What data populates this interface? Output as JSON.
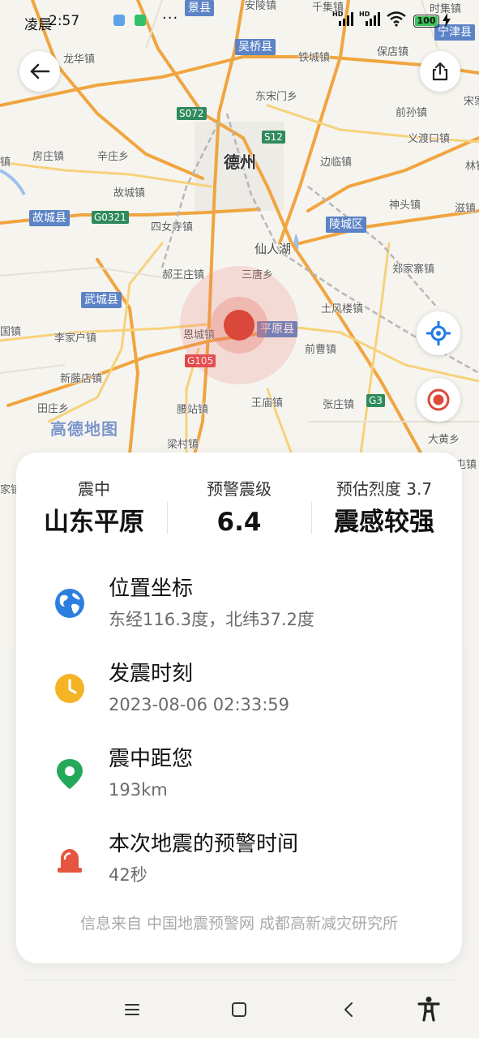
{
  "status_bar": {
    "time": "2:57",
    "weather_label": "凌晨",
    "more": "···",
    "hd1": "HD",
    "hd2": "HD",
    "battery": "100"
  },
  "map": {
    "labels": {
      "dezhou": "德州",
      "anzhen": "安陵镇",
      "qianjizhen": "千集镇",
      "longquan": "龙华镇",
      "tiechengzhen": "铁城镇",
      "baodian": "保店镇",
      "dongsongmen": "东宋门乡",
      "qiansun": "前孙镇",
      "yidukou": "义渡口镇",
      "fangzhuang": "房庄镇",
      "xinzhuang": "辛庄乡",
      "bianlin": "边临镇",
      "gucheng": "故城镇",
      "shentou": "神头镇",
      "zigou": "滋镇",
      "sinusi": "四女寺镇",
      "xianrenhu": "仙人湖",
      "haowangzhuang": "郝王庄镇",
      "sandian": "三唐乡",
      "zhengjiazhai": "郑家寨镇",
      "tufenglou": "土风楼镇",
      "lijiahu": "李家户镇",
      "encheng": "恩城镇",
      "qiancao": "前曹镇",
      "xindiandian": "新藤店镇",
      "wangmiao": "王庙镇",
      "zhangzhuang": "张庄镇",
      "tianzhuang": "田庄乡",
      "fushan": "腰站镇",
      "liangcun": "梁村镇",
      "dahuang": "大黄乡",
      "shiyuzhen": "时集镇",
      "tuncheng": "屯镇",
      "songjiadian": "宋家",
      "jiezhen": "镇",
      "guzhen": "国镇",
      "jiazhen": "家镇",
      "linzhen": "林镇",
      "gaode": "高德地图"
    },
    "counties": {
      "jingxian": "景县",
      "wuqiao": "吴桥县",
      "ningjin": "宁津县",
      "gucheng_county": "故城县",
      "lingcheng": "陵城区",
      "wucheng": "武城县",
      "pingyuan": "平原县"
    },
    "roads": {
      "s072": "S072",
      "s12": "S12",
      "g0321": "G0321",
      "g105": "G105",
      "g3": "G3"
    }
  },
  "card": {
    "epicenter_caption": "震中",
    "epicenter_value": "山东平原",
    "magnitude_caption": "预警震级",
    "magnitude_value": "6.4",
    "intensity_caption": "预估烈度 3.7",
    "intensity_value": "震感较强",
    "rows": [
      {
        "title": "位置坐标",
        "sub": "东经116.3度，北纬37.2度",
        "icon": "globe-icon"
      },
      {
        "title": "发震时刻",
        "sub": "2023-08-06 02:33:59",
        "icon": "clock-icon"
      },
      {
        "title": "震中距您",
        "sub": "193km",
        "icon": "location-pin-icon"
      },
      {
        "title": "本次地震的预警时间",
        "sub": "42秒",
        "icon": "alarm-light-icon"
      }
    ],
    "source": "信息来自 中国地震预警网 成都高新减灾研究所"
  },
  "colors": {
    "epicenter": "#d9483a",
    "globe": "#2c7fde",
    "clock": "#f5b425",
    "pin": "#26a85a",
    "alarm": "#e5553f",
    "county_tag": "#5b83c6"
  }
}
